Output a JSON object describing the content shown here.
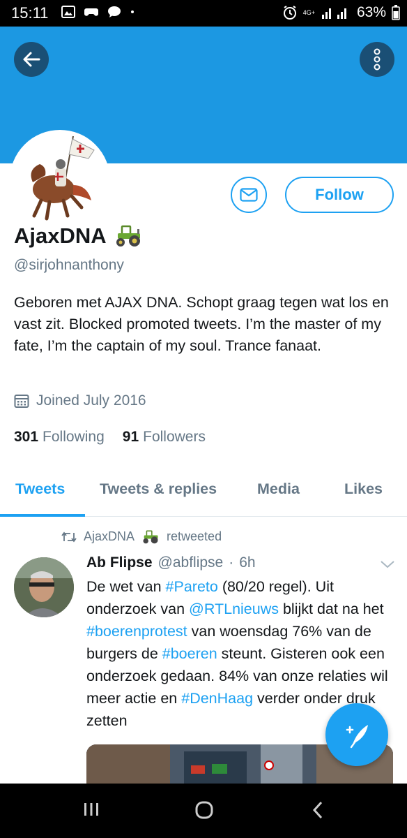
{
  "status_bar": {
    "time": "15:11",
    "network": "4G+",
    "battery": "63%"
  },
  "profile": {
    "display_name": "AjaxDNA",
    "name_emoji": "tractor-icon",
    "handle": "@sirjohnanthony",
    "bio": "Geboren met AJAX DNA. Schopt graag tegen wat los en vast zit. Blocked promoted tweets. I’m the master of my fate, I’m the captain of my soul. Trance fanaat.",
    "joined": "Joined July 2016",
    "following_count": "301",
    "following_label": "Following",
    "followers_count": "91",
    "followers_label": "Followers",
    "follow_button": "Follow"
  },
  "tabs": [
    {
      "label": "Tweets",
      "active": true
    },
    {
      "label": "Tweets & replies",
      "active": false
    },
    {
      "label": "Media",
      "active": false
    },
    {
      "label": "Likes",
      "active": false
    }
  ],
  "tweet": {
    "retweeted_by_name": "AjaxDNA",
    "retweeted_label": "retweeted",
    "author_name": "Ab Flipse",
    "author_handle": "@abflipse",
    "separator": "·",
    "time": "6h",
    "text_parts": [
      {
        "t": "De wet van ",
        "hl": false
      },
      {
        "t": "#Pareto",
        "hl": true
      },
      {
        "t": " (80/20 regel). Uit onderzoek van ",
        "hl": false
      },
      {
        "t": "@RTLnieuws",
        "hl": true
      },
      {
        "t": " blijkt dat na het ",
        "hl": false
      },
      {
        "t": "#boerenprotest",
        "hl": true
      },
      {
        "t": " van woensdag 76% van de burgers de ",
        "hl": false
      },
      {
        "t": "#boeren",
        "hl": true
      },
      {
        "t": " steunt. Gisteren ook een onderzoek gedaan. 84% van onze relaties wil meer actie en ",
        "hl": false
      },
      {
        "t": "#DenHaag",
        "hl": true
      },
      {
        "t": " verder onder druk zetten",
        "hl": false
      }
    ]
  },
  "colors": {
    "accent": "#1da1f2",
    "banner": "#1c98e2",
    "text_secondary": "#657786"
  }
}
